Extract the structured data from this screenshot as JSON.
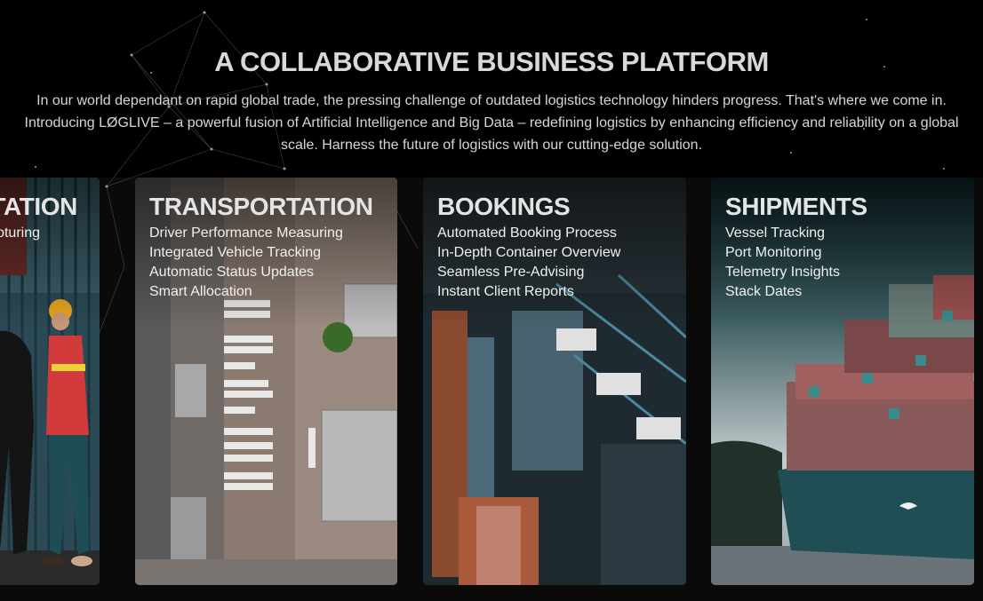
{
  "section": {
    "title": "A COLLABORATIVE BUSINESS PLATFORM",
    "intro": "In our world dependant on rapid global trade, the pressing challenge of outdated logistics technology hinders progress. That's where we come in. Introducing LØGLIVE – a powerful fusion of Artificial Intelligence and Big Data – redefining logistics by enhancing efficiency and reliability on a global scale. Harness the future of logistics with our cutting-edge solution."
  },
  "cards": [
    {
      "title": "TATION",
      "features": [
        "oturing"
      ],
      "image": "warehouse-workers-photo"
    },
    {
      "title": "TRANSPORTATION",
      "features": [
        "Driver Performance Measuring",
        "Integrated Vehicle Tracking",
        "Automatic Status Updates",
        "Smart Allocation"
      ],
      "image": "aerial-truck-yard-photo"
    },
    {
      "title": "BOOKINGS",
      "features": [
        "Automated Booking Process",
        "In-Depth Container Overview",
        "Seamless Pre-Advising",
        "Instant Client Reports"
      ],
      "image": "container-port-cranes-photo"
    },
    {
      "title": "SHIPMENTS",
      "features": [
        "Vessel Tracking",
        "Port Monitoring",
        "Telemetry Insights",
        "Stack Dates"
      ],
      "image": "container-ship-photo"
    }
  ]
}
